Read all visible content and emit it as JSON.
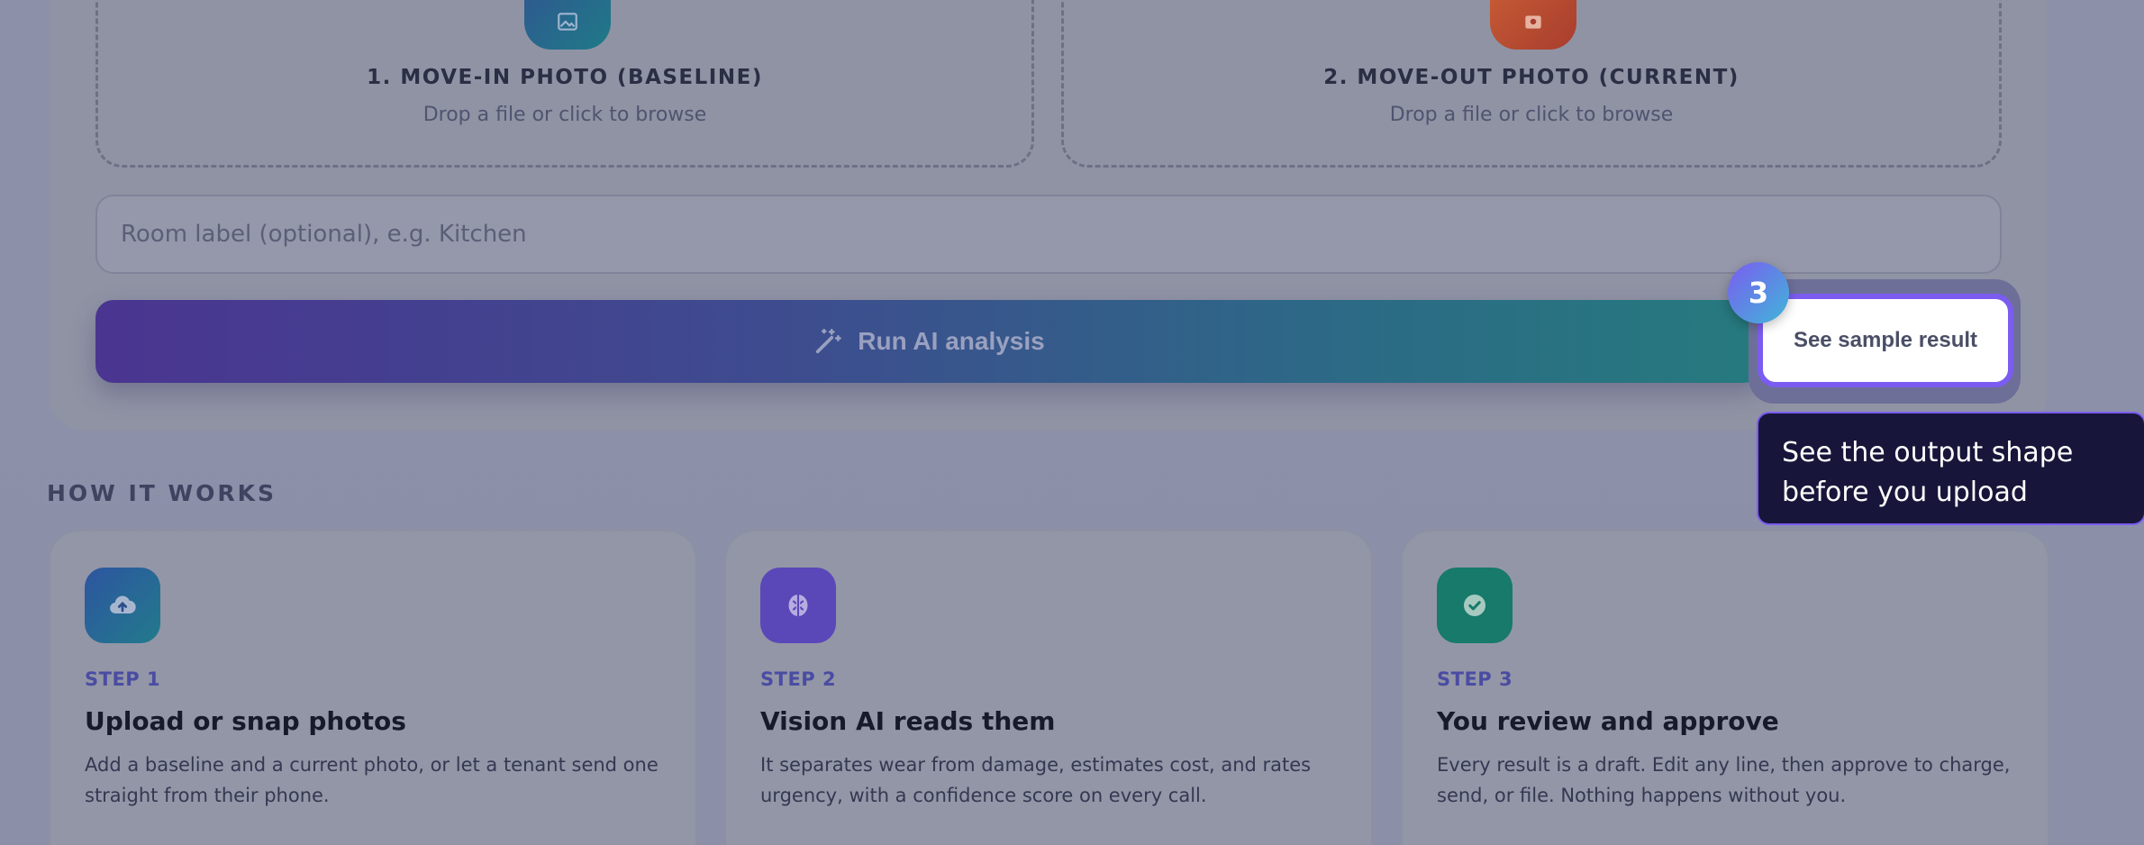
{
  "upload": {
    "baseline": {
      "icon": "image-icon",
      "title": "1. MOVE-IN PHOTO (BASELINE)",
      "hint": "Drop a file or click to browse"
    },
    "current": {
      "icon": "camera-icon",
      "title": "2. MOVE-OUT PHOTO (CURRENT)",
      "hint": "Drop a file or click to browse"
    },
    "room_placeholder": "Room label (optional), e.g. Kitchen",
    "run_label": "Run AI analysis",
    "sample_label": "See sample result"
  },
  "tour": {
    "step_number": "3",
    "tooltip": "See the output shape before you upload"
  },
  "how_it_works": {
    "label": "HOW IT WORKS",
    "steps": [
      {
        "icon": "cloud-upload-icon",
        "step": "STEP 1",
        "title": "Upload or snap photos",
        "desc": "Add a baseline and a current photo, or let a tenant send one straight from their phone."
      },
      {
        "icon": "brain-icon",
        "step": "STEP 2",
        "title": "Vision AI reads them",
        "desc": "It separates wear from damage, estimates cost, and rates urgency, with a confidence score on every call."
      },
      {
        "icon": "check-badge-icon",
        "step": "STEP 3",
        "title": "You review and approve",
        "desc": "Every result is a draft. Edit any line, then approve to charge, send, or file. Nothing happens without you."
      }
    ]
  },
  "colors": {
    "overlay": "#8b90a8",
    "accent_purple": "#7b5cf0",
    "tooltip_bg": "#17163a",
    "step_label": "#4a4ca3"
  }
}
